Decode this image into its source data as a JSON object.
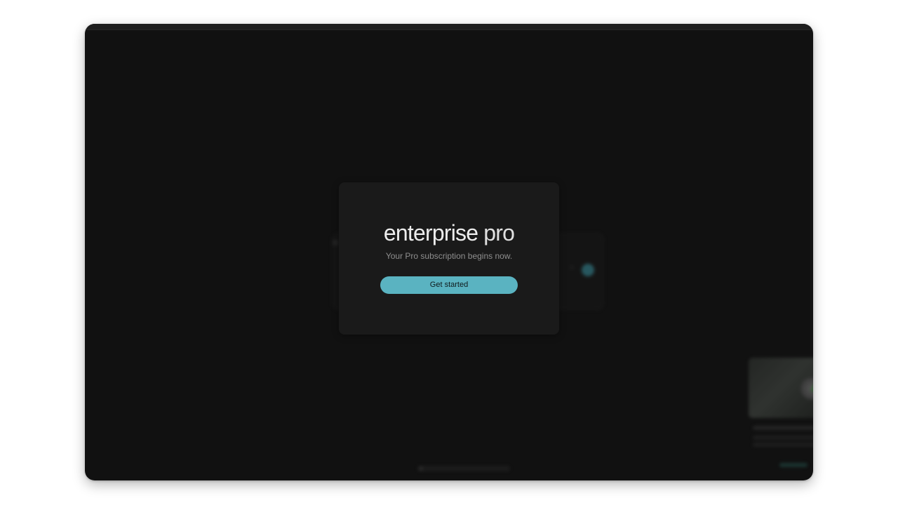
{
  "modal": {
    "brand_name": "enterprise",
    "brand_tier": "pro",
    "subtitle": "Your Pro subscription begins now.",
    "cta_label": "Get started"
  },
  "colors": {
    "accent": "#5ab3c1",
    "modal_background": "#1a1a1a",
    "app_background": "#111111",
    "page_background": "#ffffff"
  },
  "icons": {
    "background_submit": "arrow-right-icon",
    "background_attach": "paperclip-icon"
  }
}
